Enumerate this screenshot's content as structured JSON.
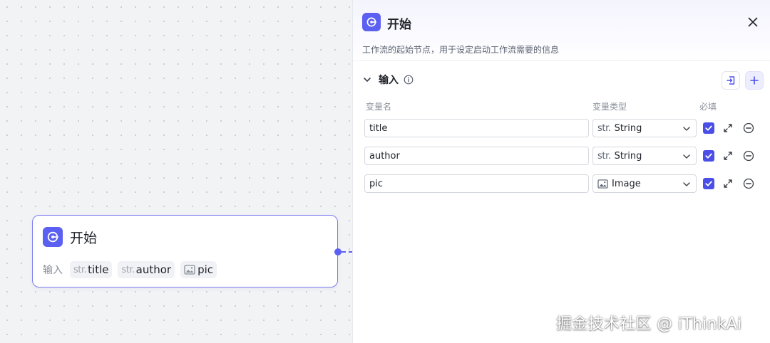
{
  "node": {
    "title": "开始",
    "inputs_label": "输入",
    "tags": [
      {
        "type": "str.",
        "name": "title"
      },
      {
        "type": "str.",
        "name": "author"
      },
      {
        "type": "image",
        "name": "pic"
      }
    ]
  },
  "panel": {
    "title": "开始",
    "description": "工作流的起始节点，用于设定启动工作流需要的信息",
    "section_title": "输入",
    "columns": {
      "name": "变量名",
      "type": "变量类型",
      "required": "必填"
    },
    "rows": [
      {
        "name": "title",
        "type_prefix": "str.",
        "type": "String",
        "required": true
      },
      {
        "name": "author",
        "type_prefix": "str.",
        "type": "String",
        "required": true
      },
      {
        "name": "pic",
        "type_prefix": "image",
        "type": "Image",
        "required": true
      }
    ]
  },
  "watermark": "掘金技术社区 @ iThinkAi",
  "colors": {
    "accent": "#5b5ff2",
    "checkbox": "#4b4fe8"
  }
}
